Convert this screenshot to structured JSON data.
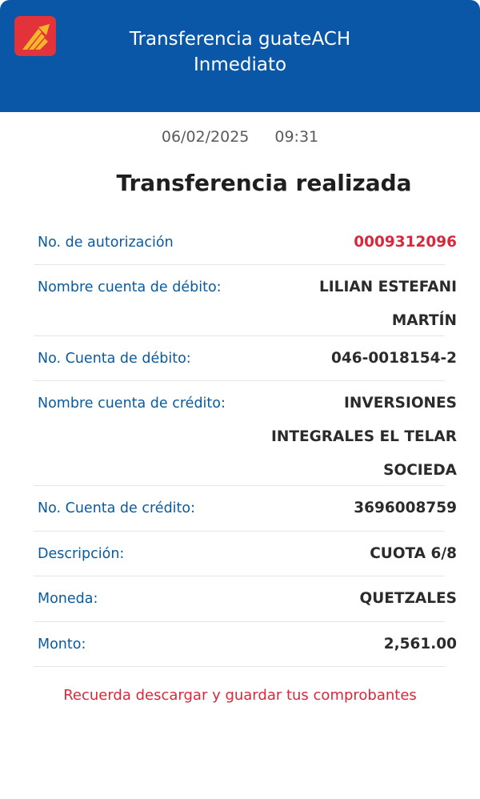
{
  "header": {
    "title_line1": "Transferencia guateACH",
    "title_line2": "Inmediato",
    "logo_icon": "bank-logo-icon",
    "color": "#0a56a7"
  },
  "date": "06/02/2025",
  "time": "09:31",
  "result_title": "Transferencia realizada",
  "details": {
    "auth": {
      "label": "No. de autorización",
      "value": "0009312096"
    },
    "debit_name": {
      "label": "Nombre cuenta de débito:",
      "value_lines": [
        "LILIAN ESTEFANI",
        "MARTÍN"
      ]
    },
    "debit_account": {
      "label": "No. Cuenta de débito:",
      "value": "046-0018154-2"
    },
    "credit_name": {
      "label": "Nombre cuenta de crédito:",
      "value_lines": [
        "INVERSIONES",
        "INTEGRALES EL TELAR",
        "SOCIEDA"
      ]
    },
    "credit_account": {
      "label": "No. Cuenta de crédito:",
      "value": "3696008759"
    },
    "description": {
      "label": "Descripción:",
      "value": "CUOTA 6/8"
    },
    "currency": {
      "label": "Moneda:",
      "value": "QUETZALES"
    },
    "amount": {
      "label": "Monto:",
      "value": "2,561.00"
    }
  },
  "reminder": "Recuerda descargar y guardar tus comprobantes",
  "colors": {
    "accent_red": "#d9283c",
    "label_blue": "#0a5a9e"
  }
}
